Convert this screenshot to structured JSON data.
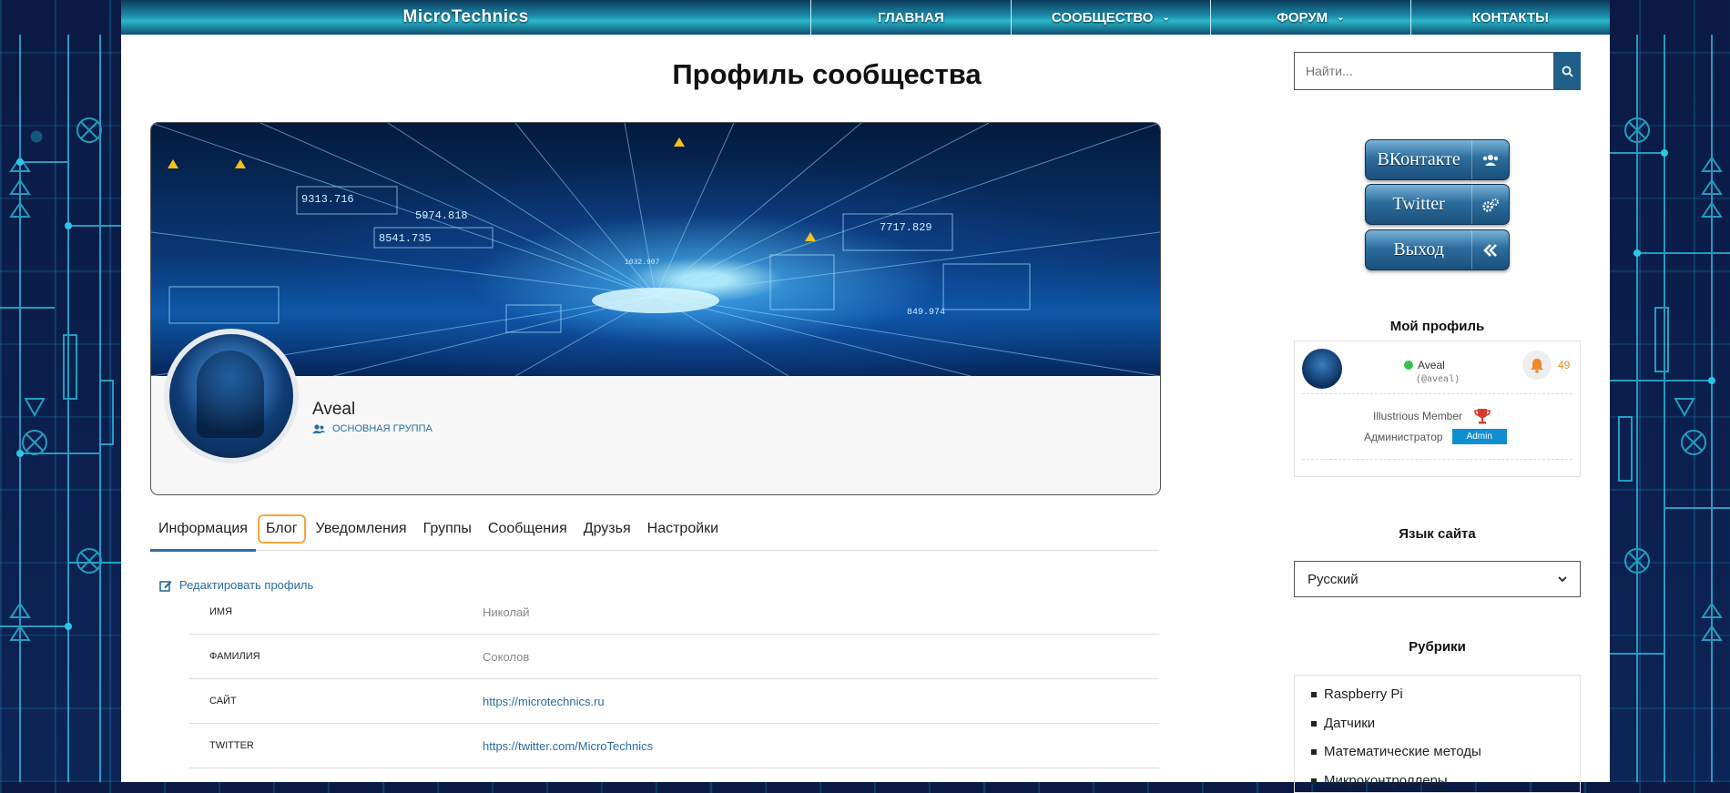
{
  "header": {
    "brand": "MicroTechnics",
    "nav": [
      {
        "label": "ГЛАВНАЯ",
        "dropdown": false
      },
      {
        "label": "СООБЩЕСТВО",
        "dropdown": true
      },
      {
        "label": "ФОРУМ",
        "dropdown": true
      },
      {
        "label": "КОНТАКТЫ",
        "dropdown": false
      }
    ]
  },
  "main": {
    "page_title": "Профиль сообщества",
    "profile": {
      "name": "Aveal",
      "group": "ОСНОВНАЯ ГРУППА",
      "cover_numbers": [
        "9313.716",
        "5974.818",
        "8541.735",
        "1032.907",
        "7717.829",
        "849.974"
      ]
    },
    "tabs": [
      "Информация",
      "Блог",
      "Уведомления",
      "Группы",
      "Сообщения",
      "Друзья",
      "Настройки"
    ],
    "edit_link": "Редактировать профиль",
    "fields": [
      {
        "label": "ИМЯ",
        "value": "Николай",
        "link": false
      },
      {
        "label": "ФАМИЛИЯ",
        "value": "Соколов",
        "link": false
      },
      {
        "label": "САЙТ",
        "value": "https://microtechnics.ru",
        "link": true
      },
      {
        "label": "TWITTER",
        "value": "https://twitter.com/MicroTechnics",
        "link": true
      }
    ]
  },
  "sidebar": {
    "search_placeholder": "Найти...",
    "social": [
      {
        "label": "ВКонтакте",
        "icon": "users-icon"
      },
      {
        "label": "Twitter",
        "icon": "gears-icon"
      },
      {
        "label": "Выход",
        "icon": "double-chevron-left-icon"
      }
    ],
    "my_profile": {
      "title": "Мой профиль",
      "name": "Aveal",
      "handle": "(@aveal)",
      "notifications": "49",
      "rank": "Illustrious Member",
      "role_label": "Администратор",
      "role_badge": "Admin"
    },
    "language": {
      "title": "Язык сайта",
      "selected": "Русский"
    },
    "categories": {
      "title": "Рубрики",
      "items": [
        "Raspberry Pi",
        "Датчики",
        "Математические методы",
        "Микроконтроллеры"
      ]
    }
  },
  "colors": {
    "accent": "#2b6ea1",
    "nav_teal": "#2bb7c9",
    "admin_badge": "#0f8fd0",
    "online": "#35c24a",
    "notif": "#e8902a"
  }
}
